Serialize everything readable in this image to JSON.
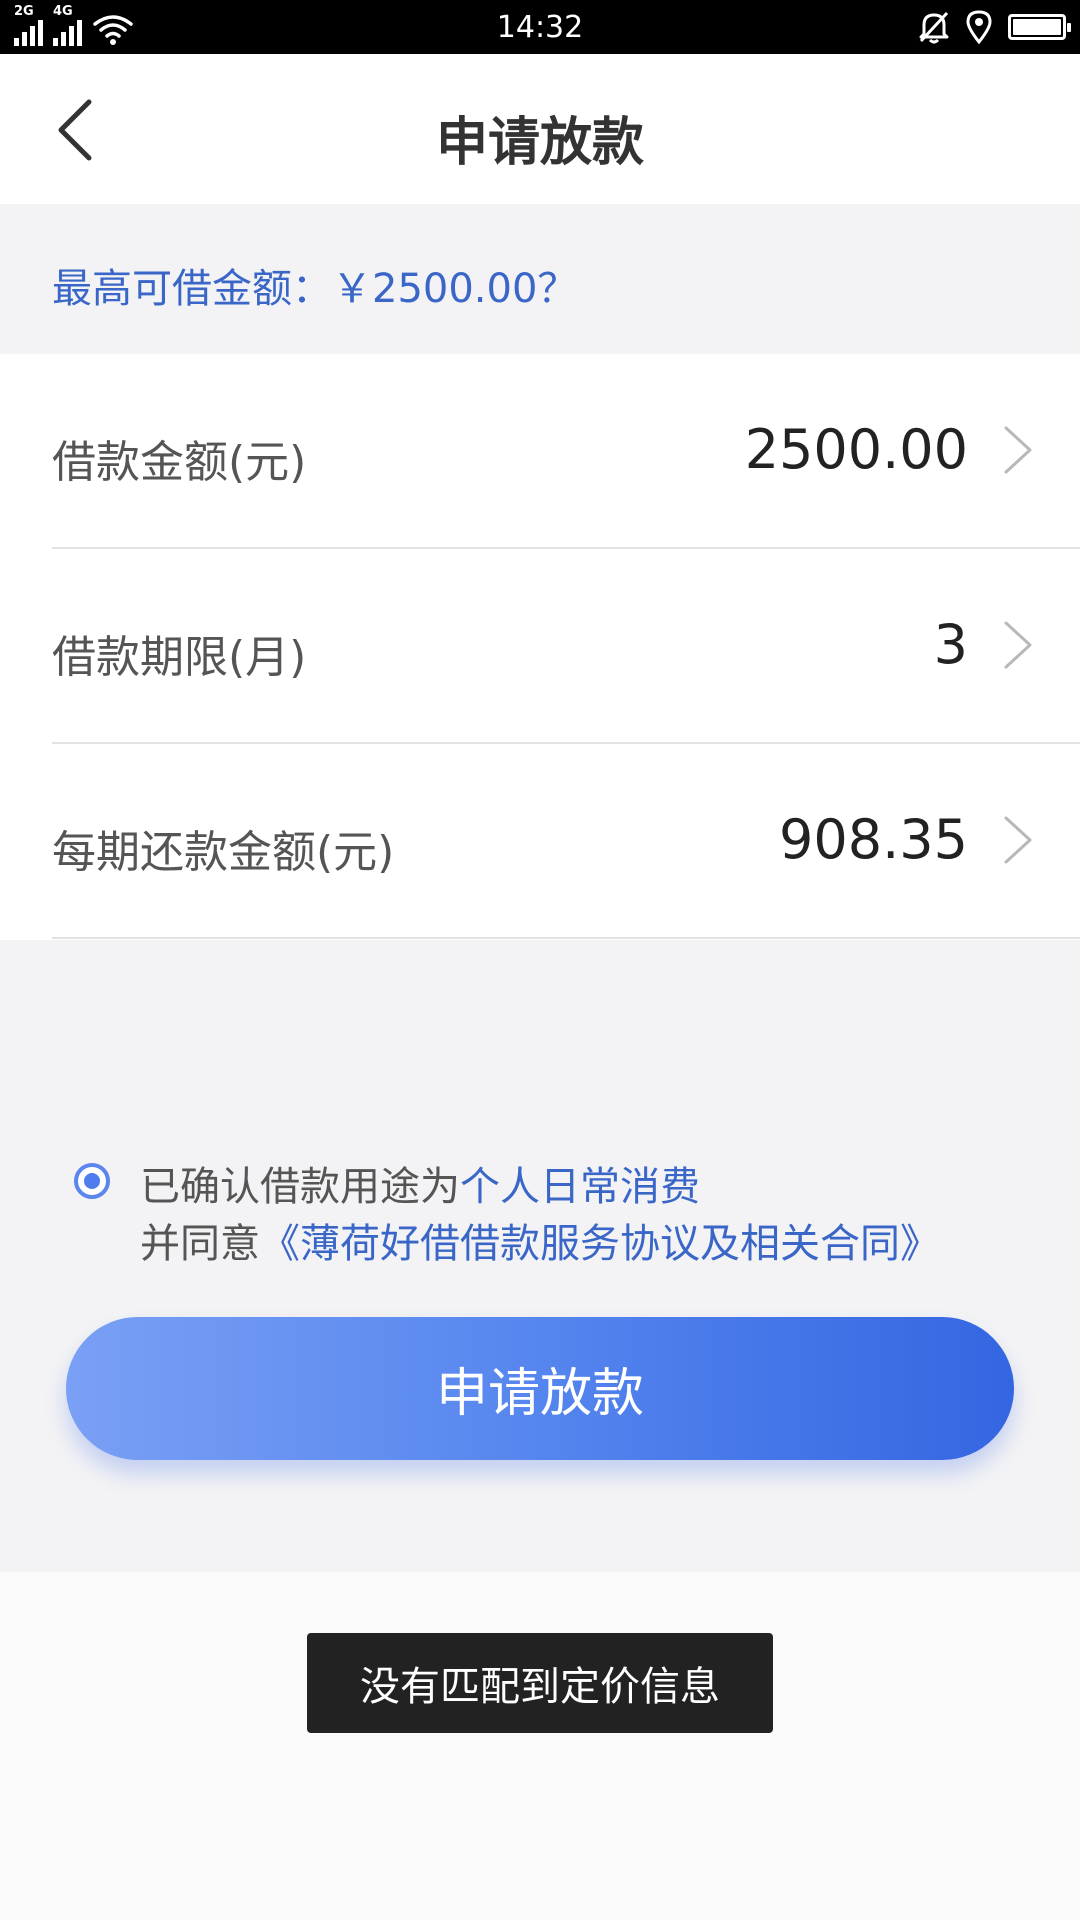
{
  "status_bar": {
    "time": "14:32",
    "network_1": "2G",
    "network_2": "4G",
    "icons": [
      "signal-icon",
      "signal-icon",
      "wifi-icon",
      "bell-mute-icon",
      "location-icon",
      "battery-icon"
    ]
  },
  "header": {
    "title": "申请放款",
    "back_icon": "chevron-left-icon"
  },
  "max_amount": {
    "text": "最高可借金额：￥2500.00？"
  },
  "form": {
    "rows": [
      {
        "label": "借款金额(元)",
        "value": "2500.00"
      },
      {
        "label": "借款期限(月)",
        "value": "3"
      },
      {
        "label": "每期还款金额(元)",
        "value": "908.35"
      }
    ]
  },
  "agreement": {
    "checked": true,
    "line1_prefix": "已确认借款用途为",
    "line1_link": "个人日常消费",
    "line2_prefix": "并同意",
    "line2_link": "《薄荷好借借款服务协议及相关合同》"
  },
  "apply_button": {
    "label": "申请放款"
  },
  "toast": {
    "text": "没有匹配到定价信息"
  },
  "colors": {
    "accent_blue": "#3a66c8",
    "button_gradient_start": "#7aa0f5",
    "button_gradient_end": "#3466e2",
    "toast_bg": "#222222"
  }
}
